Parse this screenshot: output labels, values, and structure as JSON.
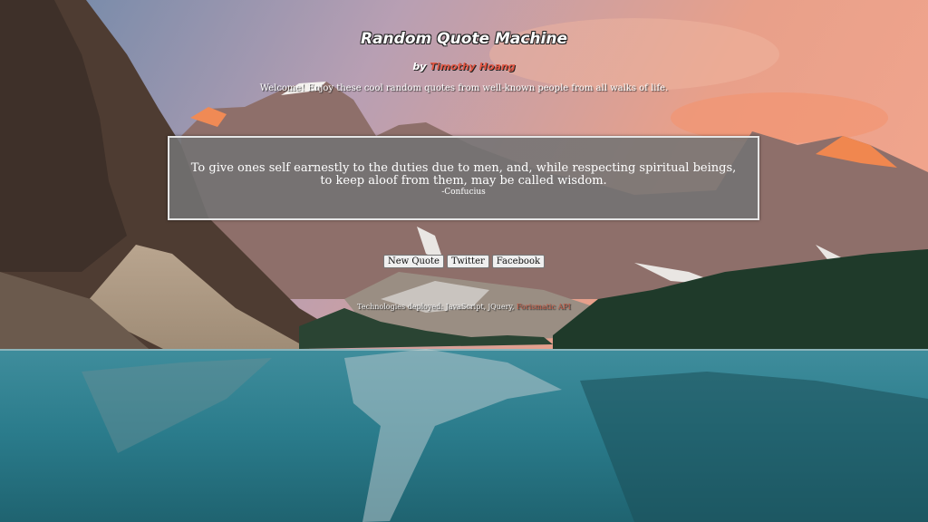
{
  "app": {
    "title": "Random Quote Machine",
    "byline_prefix": "by",
    "author_link": "Timothy Hoang",
    "welcome": "Welcome! Enjoy these cool random quotes from well-known people from all walks of life."
  },
  "quote": {
    "text": "To give ones self earnestly to the duties due to men, and, while respecting spiritual beings, to keep aloof from them, may be called wisdom.",
    "author": "-Confucius"
  },
  "buttons": {
    "new_quote": "New Quote",
    "twitter": "Twitter",
    "facebook": "Facebook"
  },
  "footer": {
    "tech_text": "Technologies deployed: JavaScript, jQuery,",
    "api_link": "Forismatic API"
  },
  "colors": {
    "link_accent": "#e25845",
    "quote_box_bg": "#737373"
  }
}
